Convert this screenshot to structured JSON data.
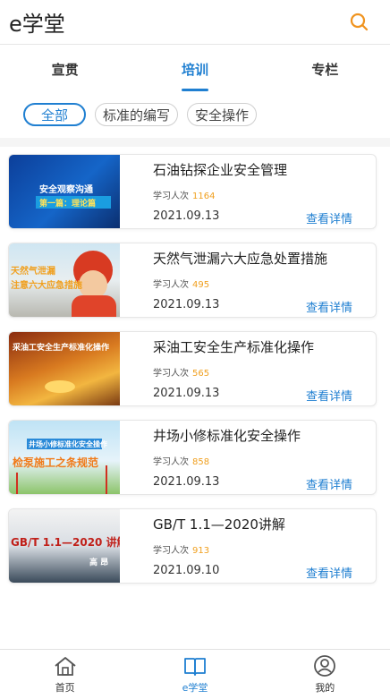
{
  "app": {
    "title": "e学堂"
  },
  "tabs": [
    {
      "label": "宣贯"
    },
    {
      "label": "培训"
    },
    {
      "label": "专栏"
    }
  ],
  "chips": [
    {
      "label": "全部"
    },
    {
      "label": "标准的编写"
    },
    {
      "label": "安全操作"
    }
  ],
  "courses": [
    {
      "title": "石油钻探企业安全管理",
      "viewers_label": "学习人次",
      "viewers": "1164",
      "date": "2021.09.13",
      "detail_label": "查看详情",
      "thumb_text": [
        "安全观察沟通",
        "第一篇：理论篇"
      ]
    },
    {
      "title": "天然气泄漏六大应急处置措施",
      "viewers_label": "学习人次",
      "viewers": "495",
      "date": "2021.09.13",
      "detail_label": "查看详情",
      "thumb_text": [
        "天然气泄漏",
        "注意六大应急措施"
      ]
    },
    {
      "title": "采油工安全生产标准化操作",
      "viewers_label": "学习人次",
      "viewers": "565",
      "date": "2021.09.13",
      "detail_label": "查看详情",
      "thumb_text": [
        "采油工安全生产标准化操作"
      ]
    },
    {
      "title": "井场小修标准化安全操作",
      "viewers_label": "学习人次",
      "viewers": "858",
      "date": "2021.09.13",
      "detail_label": "查看详情",
      "thumb_text": [
        "井场小修标准化安全操作",
        "检泵施工之条规范"
      ]
    },
    {
      "title": "GB/T 1.1—2020讲解",
      "viewers_label": "学习人次",
      "viewers": "913",
      "date": "2021.09.10",
      "detail_label": "查看详情",
      "thumb_text": [
        "GB/T 1.1—2020 讲解",
        "高 昂"
      ]
    }
  ],
  "bottom_nav": [
    {
      "label": "首页"
    },
    {
      "label": "e学堂"
    },
    {
      "label": "我的"
    }
  ],
  "colors": {
    "accent": "#1f7fd1",
    "count": "#f0a020"
  }
}
